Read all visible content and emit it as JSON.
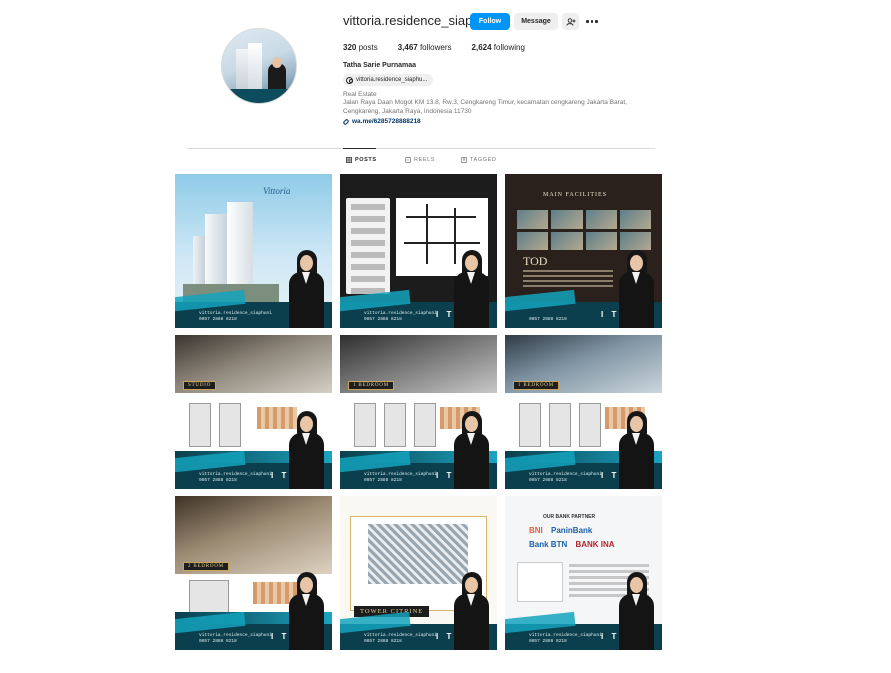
{
  "profile": {
    "username": "vittoria.residence_siaphuni",
    "follow_label": "Follow",
    "message_label": "Message",
    "stats": [
      {
        "value": "320",
        "label": " posts"
      },
      {
        "value": "3,467",
        "label": " followers"
      },
      {
        "value": "2,624",
        "label": " following"
      }
    ],
    "full_name": "Tatha Sarie Purnamaa",
    "threads_handle": "vittoria.residence_siaphu...",
    "category": "Real Estate",
    "address": "Jalan Raya Daan Mogot KM 13.8, Rw.3, Cengkareng Timur, kecamatan cengkareng Jakarta Barat, Cengkareng, Jakarta Raya, Indonesia 11730",
    "link": "wa.me/6285728888218"
  },
  "tabs": [
    {
      "label": "POSTS",
      "icon": "grid-icon",
      "active": true
    },
    {
      "label": "REELS",
      "icon": "reels-icon",
      "active": false
    },
    {
      "label": "TAGGED",
      "icon": "tagged-icon",
      "active": false
    }
  ],
  "posts": {
    "p1": {
      "logo": "Vittoria",
      "footer": "vittoria.residence_siaphuni\n0857 2888 8218",
      "agent": "I T A"
    },
    "p2": {
      "footer": "vittoria.residence_siaphuni\n0857 2888 8218",
      "agent": "I T A"
    },
    "p3": {
      "title": "MAIN FACILITIES",
      "badge": "TOD",
      "footer": "0857 2888 8218",
      "agent": "I T A"
    },
    "p4": {
      "room": "STUDIO",
      "footer": "vittoria.residence_siaphuni\n0857 2888 8218",
      "agent": "I T A"
    },
    "p5": {
      "room": "1 BEDROOM",
      "footer": "vittoria.residence_siaphuni\n0857 2888 8218",
      "agent": "I T A"
    },
    "p6": {
      "room": "1 BEDROOM",
      "footer": "vittoria.residence_siaphuni\n0857 2888 8218",
      "agent": "I T A"
    },
    "p7": {
      "room": "2 BEDROOM",
      "footer": "vittoria.residence_siaphuni\n0857 2888 8218",
      "agent": "I T A"
    },
    "p8": {
      "tower": "TOWER CITRINE",
      "footer": "vittoria.residence_siaphuni\n0857 2888 8218",
      "agent": "I T A"
    },
    "p9": {
      "title": "OUR BANK PARTNER",
      "banks": [
        "BNI",
        "PaninBank",
        "Bank BTN",
        "BANK INA"
      ],
      "footer": "vittoria.residence_siaphuni\n0857 2888 8218",
      "agent": "I T A"
    }
  },
  "colors": {
    "follow_blue": "#0095f6",
    "accent_teal": "#13a3bd",
    "footer_teal": "#0b3f4d",
    "link_blue": "#00376b"
  }
}
